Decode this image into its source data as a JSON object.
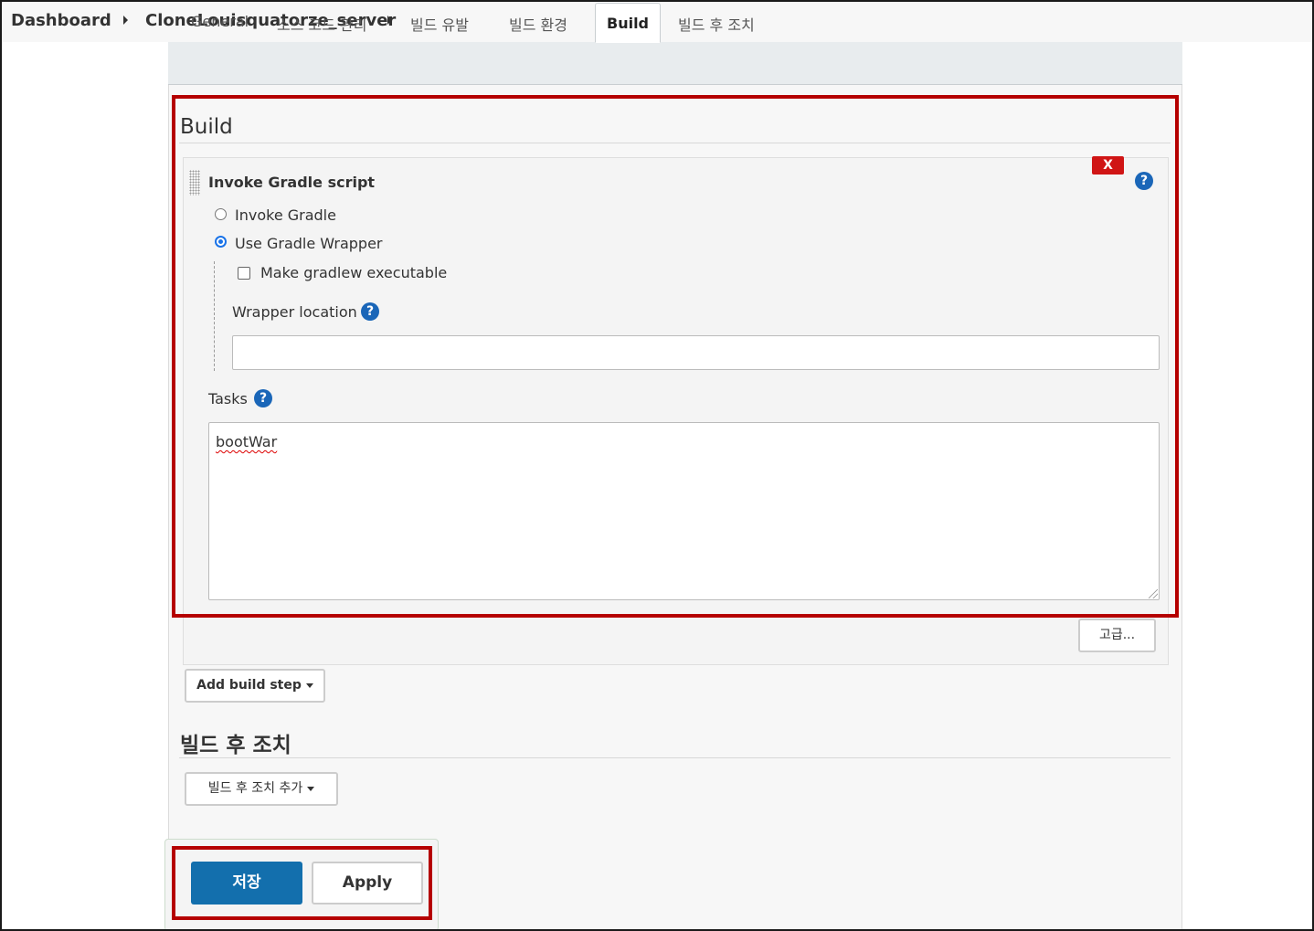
{
  "breadcrumb": {
    "items": [
      "Dashboard",
      "CloneLouisquatorze_server"
    ]
  },
  "tabs": [
    {
      "label": "General",
      "active": false
    },
    {
      "label": "소스 코드 관리",
      "active": false
    },
    {
      "label": "빌드 유발",
      "active": false
    },
    {
      "label": "빌드 환경",
      "active": false
    },
    {
      "label": "Build",
      "active": true
    },
    {
      "label": "빌드 후 조치",
      "active": false
    }
  ],
  "build_section": {
    "title": "Build",
    "step": {
      "title": "Invoke Gradle script",
      "delete_label": "X",
      "help_symbol": "?",
      "options": [
        {
          "label": "Invoke Gradle",
          "selected": false
        },
        {
          "label": "Use Gradle Wrapper",
          "selected": true
        }
      ],
      "make_executable": {
        "label": "Make gradlew executable",
        "checked": false
      },
      "wrapper_location": {
        "label": "Wrapper location",
        "value": ""
      },
      "tasks": {
        "label": "Tasks",
        "value": "bootWar"
      },
      "advanced_label": "고급..."
    },
    "add_step_label": "Add build step"
  },
  "post_build_section": {
    "title": "빌드 후 조치",
    "add_label": "빌드 후 조치 추가"
  },
  "actions": {
    "save_label": "저장",
    "apply_label": "Apply"
  },
  "colors": {
    "primary": "#136fad",
    "help": "#1a66b8",
    "delete": "#d01515",
    "highlight": "#b50000"
  }
}
